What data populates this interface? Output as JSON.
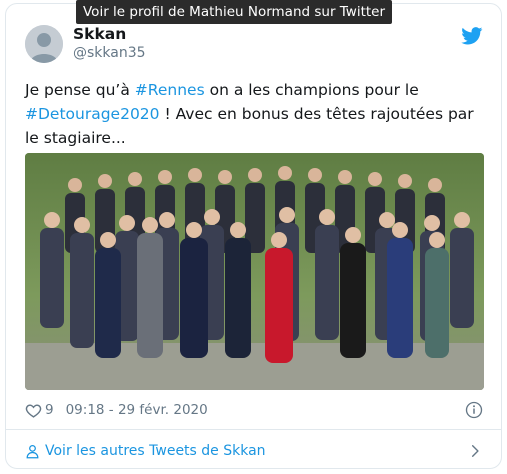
{
  "tooltip": "Voir le profil de Mathieu Normand sur Twitter",
  "author": {
    "display_name": "Skkan",
    "handle": "@skkan35"
  },
  "tweet": {
    "part1": "Je pense qu’à ",
    "hashtag1": "#Rennes",
    "part2": " on a les champions pour le ",
    "hashtag2": "#Detourage2020",
    "part3": " ! Avec en bonus des têtes rajoutées par le stagiaire..."
  },
  "meta": {
    "likes": "9",
    "timestamp": "09:18 - 29 févr. 2020"
  },
  "footer": {
    "more_tweets_label": "Voir les autres Tweets de Skkan"
  },
  "icons": {
    "logo": "twitter-bird-icon",
    "like": "heart-icon",
    "info": "info-icon",
    "profile": "person-icon",
    "next": "chevron-right-icon"
  },
  "colors": {
    "link": "#1b95e0",
    "muted": "#657786",
    "text": "#14171a",
    "border": "#e1e8ed"
  }
}
